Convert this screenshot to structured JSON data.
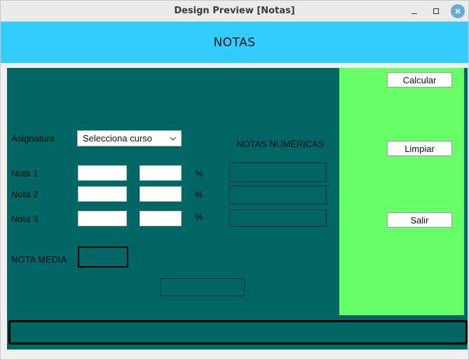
{
  "window": {
    "title": "Design Preview [Notas]"
  },
  "header": {
    "title": "NOTAS"
  },
  "form": {
    "asignatura_label": "Asignatura",
    "asignatura_select": "Selecciona curso",
    "notas_numericas_label": "NOTAS NUMÉRICAS",
    "rows": [
      {
        "label": "Nota 1",
        "percent": "%"
      },
      {
        "label": "Nota 2",
        "percent": "%"
      },
      {
        "label": "Nota 3",
        "percent": "%"
      }
    ],
    "nota_media_label": "NOTA MEDIA"
  },
  "buttons": {
    "calcular": "Calcular",
    "limpiar": "Limpiar",
    "salir": "Salir"
  },
  "colors": {
    "header": "#33ccff",
    "panel": "#006666",
    "side": "#66ff66"
  }
}
